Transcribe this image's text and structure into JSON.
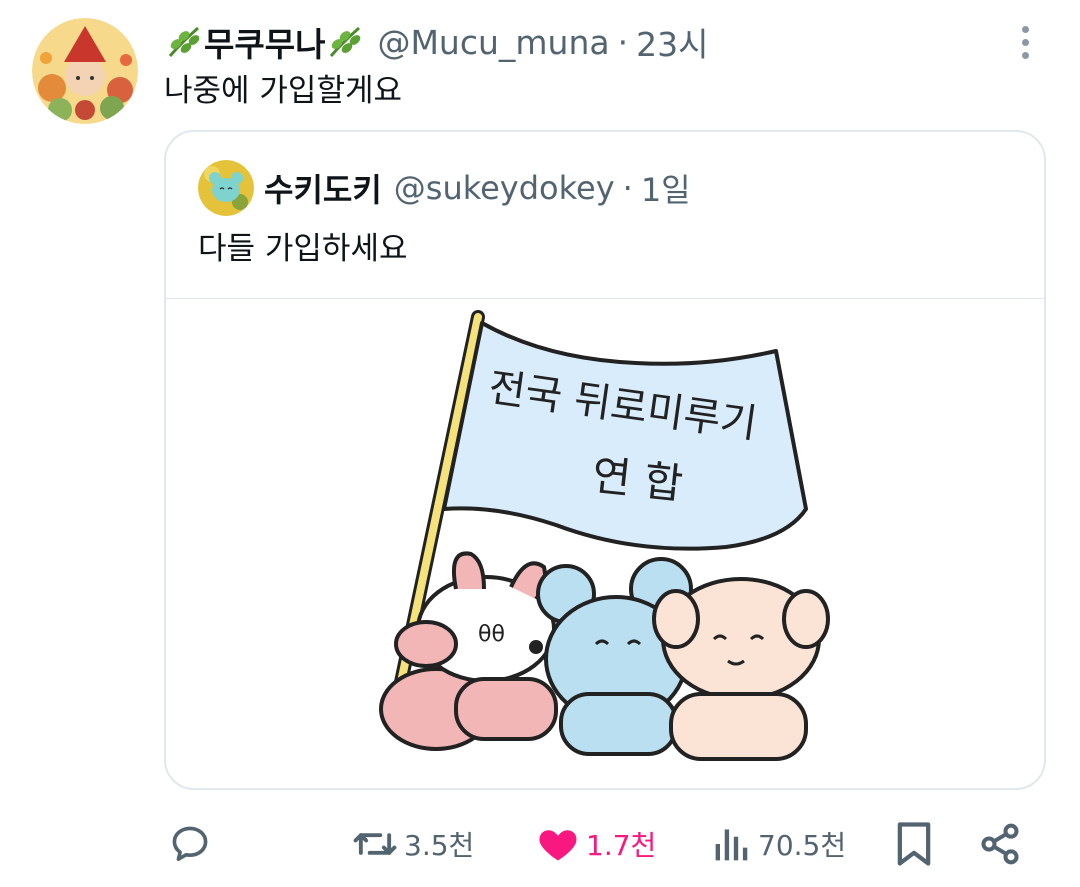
{
  "tweet": {
    "display_name": "무쿠무나",
    "handle": "@Mucu_muna",
    "separator": "·",
    "time": "23시",
    "text": "나중에 가입할게요"
  },
  "quoted": {
    "display_name": "수키도키",
    "handle": "@sukeydokey",
    "separator": "·",
    "time": "1일",
    "text": "다들 가입하세요",
    "image_flag_text": [
      "전국 뒤로미루기",
      "연 합"
    ]
  },
  "actions": {
    "reply_count": "",
    "retweet_count": "3.5천",
    "like_count": "1.7천",
    "views_count": "70.5천"
  },
  "colors": {
    "like": "#f91880",
    "icon_gray": "#536471",
    "border": "#e1e8ed",
    "flag": "#d9ecfb"
  },
  "icons": [
    "more-vertical-icon",
    "reply-icon",
    "retweet-icon",
    "heart-icon",
    "views-icon",
    "bookmark-icon",
    "share-icon",
    "leaf-icon"
  ]
}
